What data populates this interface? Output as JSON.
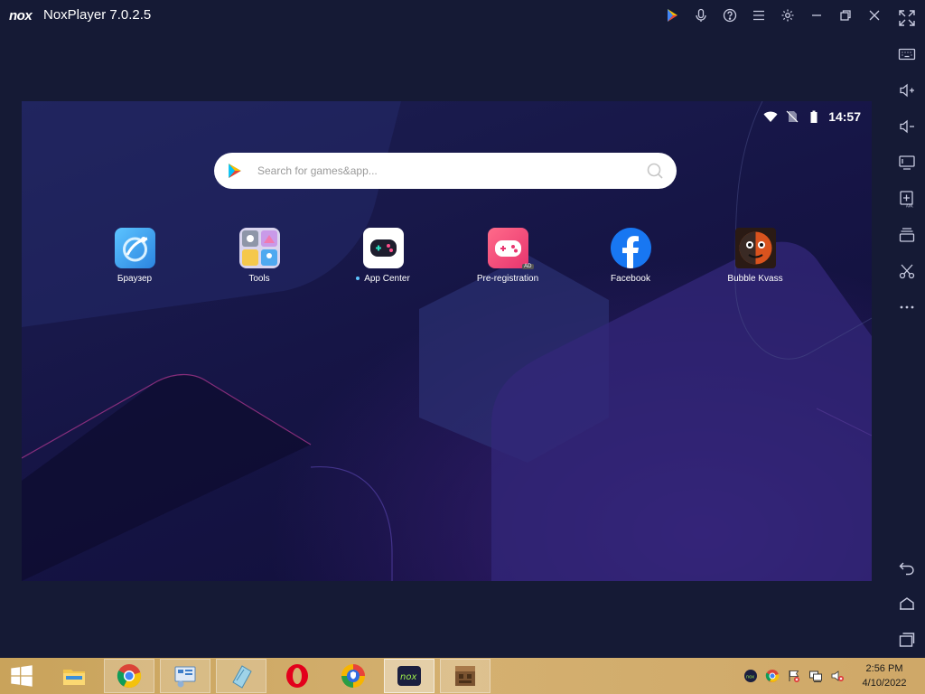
{
  "window": {
    "logo": "nox",
    "title": "NoxPlayer 7.0.2.5",
    "title_buttons": [
      "play-store-icon",
      "microphone-icon",
      "help-icon",
      "menu-icon",
      "settings-icon",
      "minimize-icon",
      "restore-icon",
      "close-icon"
    ]
  },
  "sidebar": {
    "buttons": [
      "fullscreen-icon",
      "keyboard-icon",
      "volume-up-icon",
      "volume-down-icon",
      "screen-icon",
      "add-apk-icon",
      "multi-instance-icon",
      "screenshot-scissors-icon",
      "more-icon",
      "back-icon",
      "home-icon",
      "recent-apps-icon"
    ]
  },
  "status_bar": {
    "time": "14:57"
  },
  "search": {
    "placeholder": "Search for games&app..."
  },
  "apps": [
    {
      "label": "Браузер",
      "icon": "browser-icon",
      "color": "#3aa0ee"
    },
    {
      "label": "Tools",
      "icon": "tools-folder-icon",
      "color": "#d9d4ee"
    },
    {
      "label": "App Center",
      "icon": "app-center-icon",
      "color": "#ffffff",
      "has_dot": true
    },
    {
      "label": "Pre-registration",
      "icon": "pre-registration-icon",
      "color": "#f0487a",
      "badge": "AD"
    },
    {
      "label": "Facebook",
      "icon": "facebook-icon",
      "color": "#1877f2"
    },
    {
      "label": "Bubble Kvass",
      "icon": "bubble-kvass-icon",
      "color": "#d9531e"
    }
  ],
  "taskbar": {
    "apps": [
      "file-explorer-icon",
      "chrome-icon",
      "control-panel-icon",
      "notepad-icon",
      "opera-icon",
      "browser-shield-icon",
      "nox-icon",
      "minecraft-icon"
    ],
    "tray": [
      "nox-tray-icon",
      "chrome-tray-icon",
      "flag-icon",
      "network-icon",
      "volume-muted-icon"
    ],
    "time": "2:56 PM",
    "date": "4/10/2022"
  }
}
